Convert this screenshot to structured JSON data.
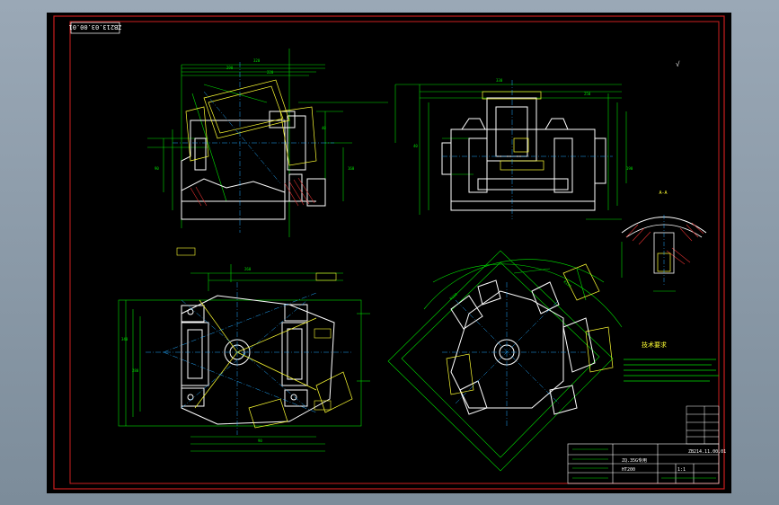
{
  "drawing": {
    "corner_code": "ZB213.03.00.01",
    "drawing_number": "ZB214.11.00.01",
    "part_name": "ZQ.35G专用",
    "tech_title": "技术要求",
    "section_label": "A-A",
    "roughness_note": "√",
    "material_small": "HT200",
    "scale_text": "1:1"
  },
  "colors": {
    "background": "#000000",
    "frame": "#cc1f1f",
    "outline": "#ffffff",
    "dimension": "#00e000",
    "centerline": "#22a8ff",
    "annotation": "#ffff33",
    "hatch": "#e03030"
  }
}
